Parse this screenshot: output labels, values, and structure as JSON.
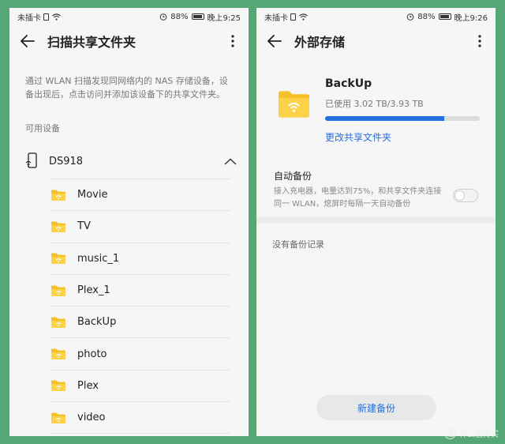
{
  "left": {
    "status": {
      "carrier": "未插卡",
      "battery": "88%",
      "time": "晚上9:25"
    },
    "title": "扫描共享文件夹",
    "description": "通过 WLAN 扫描发现同网络内的 NAS 存储设备，设备出现后，点击访问并添加该设备下的共享文件夹。",
    "section_label": "可用设备",
    "device": {
      "name": "DS918"
    },
    "folders": [
      "Movie",
      "TV",
      "music_1",
      "Plex_1",
      "BackUp",
      "photo",
      "Plex",
      "video"
    ]
  },
  "right": {
    "status": {
      "carrier": "未插卡",
      "battery": "88%",
      "time": "晚上9:26"
    },
    "title": "外部存储",
    "nas": {
      "name": "BackUp",
      "usage": "已使用 3.02 TB/3.93 TB",
      "used_fraction": 0.768,
      "change_link": "更改共享文件夹"
    },
    "auto_backup": {
      "title": "自动备份",
      "description": "接入充电器，电量达到75%，和共享文件夹连接同一 WLAN，熄屏时每隔一天自动备份",
      "enabled": false
    },
    "no_records": "没有备份记录",
    "new_backup_button": "新建备份"
  },
  "colors": {
    "background": "#55a776",
    "accent": "#256fdd",
    "folder": "#f6c028"
  },
  "watermark": {
    "text": "什么值得买"
  }
}
